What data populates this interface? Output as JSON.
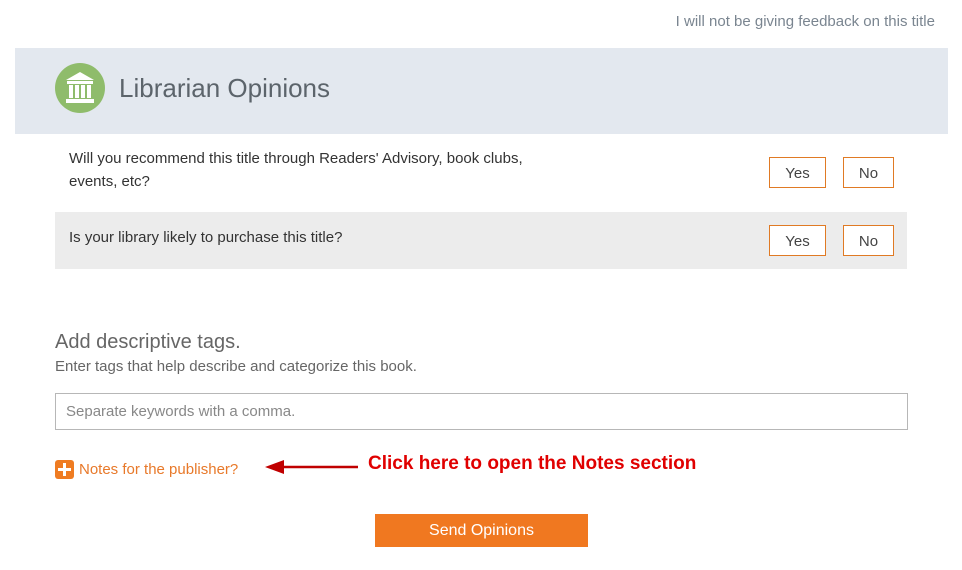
{
  "skip_link": "I will not be giving feedback on this title",
  "header": {
    "title": "Librarian Opinions",
    "icon": "library-building-icon",
    "icon_color": "#8fbc6b"
  },
  "questions": [
    {
      "text": "Will you recommend this title through Readers' Advisory, book clubs, events, etc?",
      "yes_label": "Yes",
      "no_label": "No"
    },
    {
      "text": "Is your library likely to purchase this title?",
      "yes_label": "Yes",
      "no_label": "No"
    }
  ],
  "tags": {
    "heading": "Add descriptive tags.",
    "subtext": "Enter tags that help describe and categorize this book.",
    "placeholder": "Separate keywords with a comma.",
    "value": ""
  },
  "notes": {
    "label": "Notes for the publisher?",
    "icon": "plus-icon"
  },
  "annotation": {
    "text": "Click here to open the Notes section",
    "color": "#e00000"
  },
  "send_button": "Send Opinions",
  "colors": {
    "accent": "#f07820",
    "header_bg": "#e3e8ef"
  }
}
